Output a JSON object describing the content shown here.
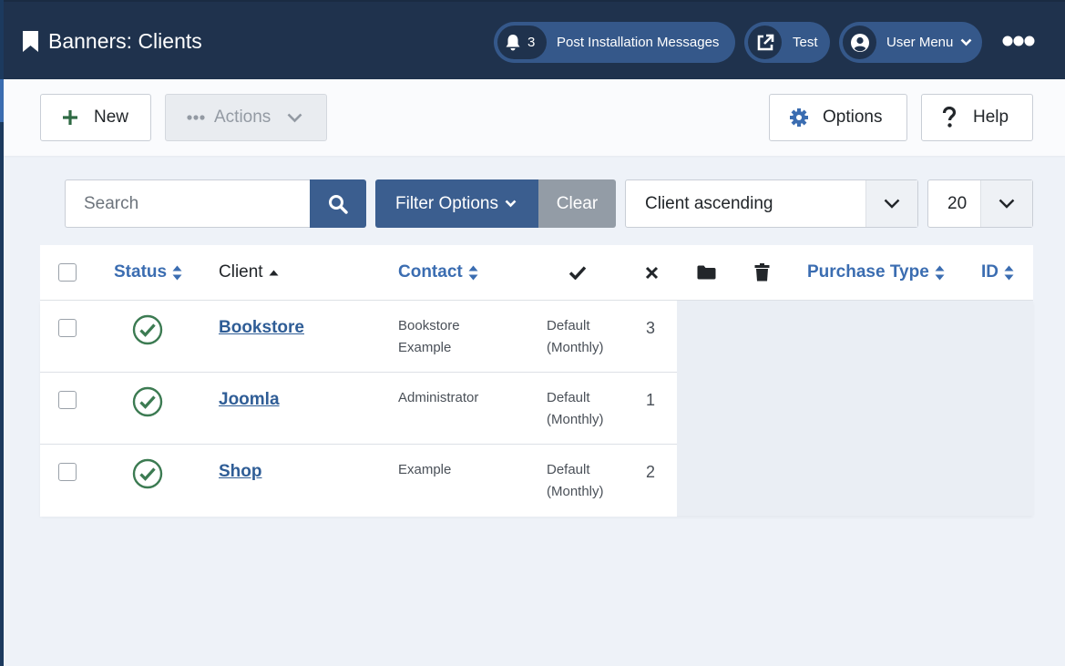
{
  "header": {
    "title": "Banners: Clients",
    "notifications_count": "3",
    "post_install_label": "Post Installation Messages",
    "test_label": "Test",
    "user_menu_label": "User Menu"
  },
  "toolbar": {
    "new_label": "New",
    "actions_label": "Actions",
    "options_label": "Options",
    "help_label": "Help"
  },
  "filters": {
    "search_placeholder": "Search",
    "filter_options_label": "Filter Options",
    "clear_label": "Clear",
    "sort_value": "Client ascending",
    "limit_value": "20"
  },
  "table": {
    "columns": {
      "status": "Status",
      "client": "Client",
      "contact": "Contact",
      "purchase_type": "Purchase Type",
      "id": "ID"
    },
    "rows": [
      {
        "client": "Bookstore",
        "contact": "Bookstore Example",
        "purchase_type": "Default (Monthly)",
        "id": "3"
      },
      {
        "client": "Joomla",
        "contact": "Administrator",
        "purchase_type": "Default (Monthly)",
        "id": "1"
      },
      {
        "client": "Shop",
        "contact": "Example",
        "purchase_type": "Default (Monthly)",
        "id": "2"
      }
    ]
  },
  "colors": {
    "header_bg": "#1f324d",
    "pill_bg": "#35588a",
    "primary": "#3b5e8f",
    "link": "#2f5d96",
    "success": "#3c7b52"
  },
  "icons": [
    "bookmark-icon",
    "bell-icon",
    "external-link-icon",
    "user-icon",
    "chevron-down-icon",
    "more-icon",
    "plus-icon",
    "dots-icon",
    "gear-icon",
    "question-icon",
    "search-icon",
    "sort-icon",
    "check-icon",
    "times-icon",
    "folder-icon",
    "trash-icon",
    "check-circle-icon"
  ]
}
